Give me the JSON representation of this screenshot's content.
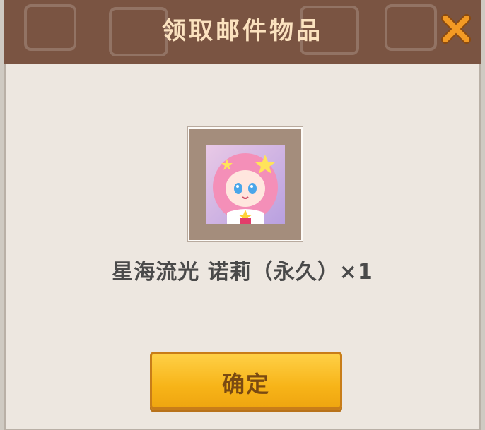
{
  "dialog": {
    "title": "领取邮件物品",
    "close_icon": "close-x-icon",
    "item": {
      "icon": "avatar-skin-icon",
      "caption": "星海流光 诺莉（永久）×1"
    },
    "confirm_label": "确定"
  },
  "colors": {
    "header_bg": "#7a5442",
    "title_text": "#fbe2bf",
    "dialog_bg": "#ede7e0",
    "close_icon": "#f39a24",
    "button_fill": "#f7b418",
    "button_text": "#7a4a12"
  }
}
